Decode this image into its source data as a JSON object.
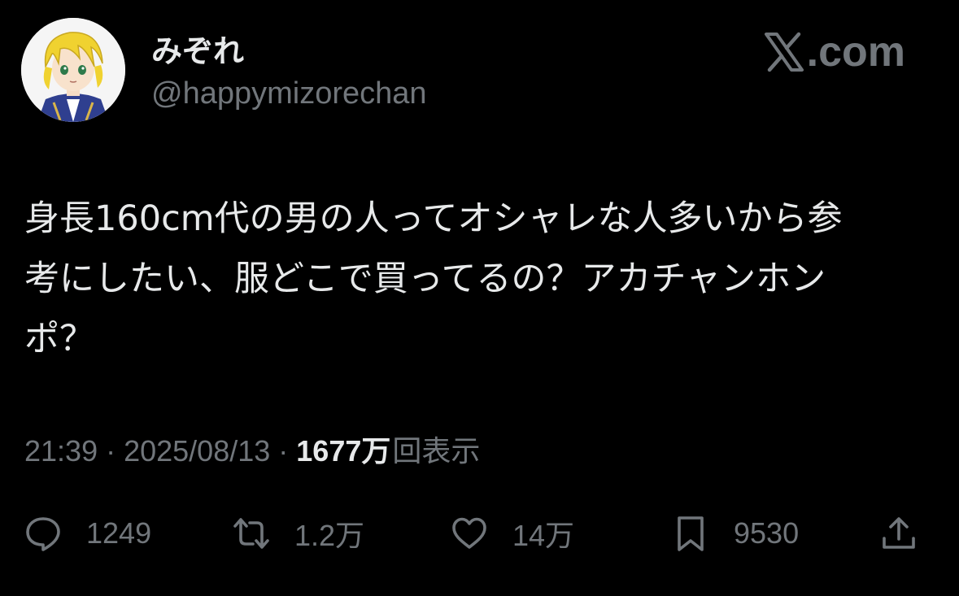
{
  "author": {
    "display_name": "みぞれ",
    "handle": "@happymizorechan"
  },
  "brand": {
    "logo_icon": "x-logo-icon",
    "suffix": ".com"
  },
  "tweet": {
    "text": "身長160cm代の男の人ってオシャレな人多いから参\n考にしたい、服どこで買ってるの？アカチャンホン\nポ？"
  },
  "meta": {
    "time": "21:39",
    "separator": "·",
    "date": "2025/08/13",
    "views_count": "1677万",
    "views_label": "回表示"
  },
  "actions": {
    "reply": {
      "icon": "reply-icon",
      "count": "1249"
    },
    "retweet": {
      "icon": "retweet-icon",
      "count": "1.2万"
    },
    "like": {
      "icon": "heart-icon",
      "count": "14万"
    },
    "bookmark": {
      "icon": "bookmark-icon",
      "count": "9530"
    },
    "share": {
      "icon": "share-icon"
    }
  },
  "colors": {
    "background": "#000000",
    "primary_text": "#e7e9ea",
    "secondary_text": "#71767b"
  }
}
